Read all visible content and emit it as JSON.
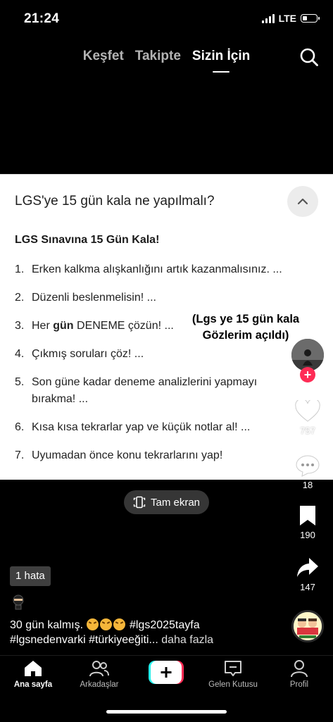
{
  "status": {
    "time": "21:24",
    "network": "LTE",
    "battery_level": 0.3
  },
  "top_tabs": [
    {
      "label": "Keşfet",
      "active": false
    },
    {
      "label": "Takipte",
      "active": false
    },
    {
      "label": "Sizin İçin",
      "active": true
    }
  ],
  "card": {
    "question": "LGS'ye 15 gün kala ne yapılmalı?",
    "heading": "LGS Sınavına 15 Gün Kala!",
    "tips": [
      {
        "num": "1.",
        "text": "Erken kalkma alışkanlığını artık kazanmalısınız. ..."
      },
      {
        "num": "2.",
        "text": "Düzenli beslenmelisin! ..."
      },
      {
        "num": "3.",
        "pre": "Her ",
        "bold": "gün",
        "post": " DENEME çözün! ..."
      },
      {
        "num": "4.",
        "text": "Çıkmış soruları çöz! ..."
      },
      {
        "num": "5.",
        "text": "Son güne kadar deneme analizlerini yapmayı bırakma! ..."
      },
      {
        "num": "6.",
        "text": "Kısa kısa tekrarlar yap ve küçük notlar al! ..."
      },
      {
        "num": "7.",
        "text": "Uyumadan önce konu tekrarlarını yap!"
      }
    ]
  },
  "overlay_caption": "(Lgs ye 15 gün kala Gözlerim açıldı)",
  "fullscreen_label": "Tam ekran",
  "actions": {
    "likes": "757",
    "comments": "18",
    "saves": "190",
    "shares": "147"
  },
  "error_badge": "1 hata",
  "video_caption": {
    "lead": "30 gün kalmış.",
    "tags_line1": "#lgs2025tayfa",
    "tags_line2": "#lgsnedenvarki #türkiyeeğiti...",
    "more": " daha fazla"
  },
  "bottom_nav": [
    {
      "label": "Ana sayfa",
      "icon": "home-icon",
      "active": true
    },
    {
      "label": "Arkadaşlar",
      "icon": "friends-icon",
      "active": false
    },
    {
      "label": "",
      "icon": "plus-icon",
      "active": false
    },
    {
      "label": "Gelen Kutusu",
      "icon": "inbox-icon",
      "active": false
    },
    {
      "label": "Profil",
      "icon": "profile-icon",
      "active": false
    }
  ],
  "colors": {
    "accent": "#fe2c55",
    "tiktok_cyan": "#25f4ee",
    "card_bg": "#ffffff"
  }
}
